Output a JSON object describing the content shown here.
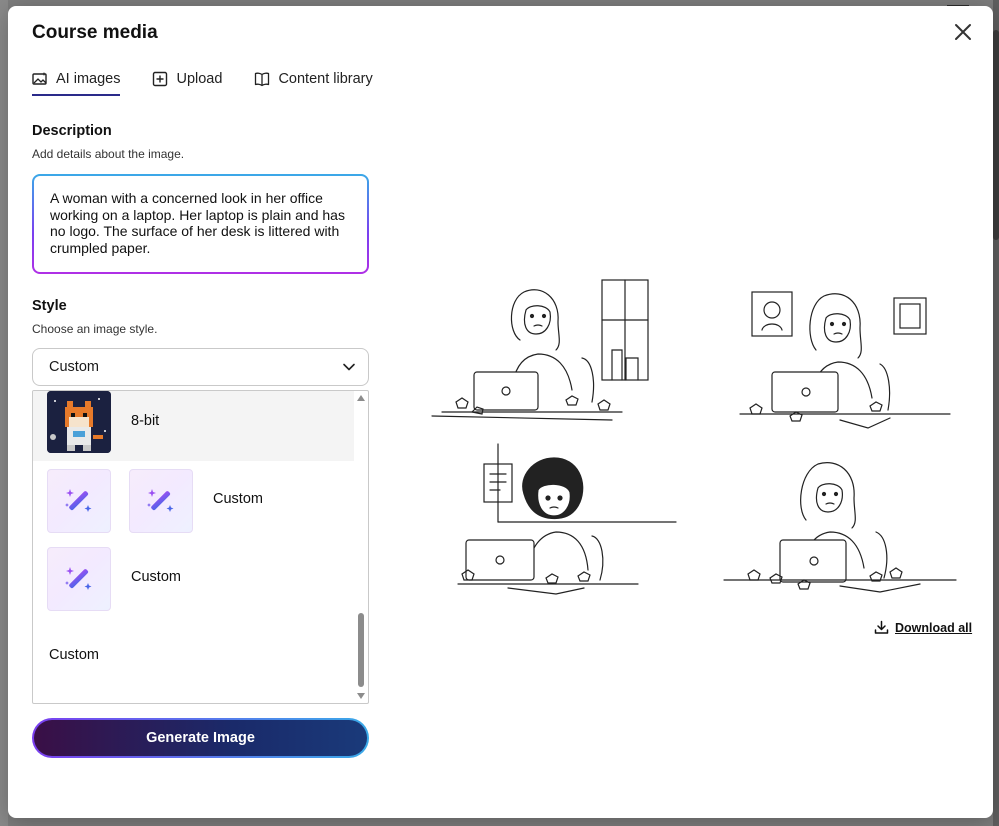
{
  "modal": {
    "title": "Course media"
  },
  "tabs": [
    {
      "label": "AI images",
      "icon": "image-sparkle-icon",
      "active": true
    },
    {
      "label": "Upload",
      "icon": "plus-square-icon",
      "active": false
    },
    {
      "label": "Content library",
      "icon": "book-icon",
      "active": false
    }
  ],
  "description": {
    "label": "Description",
    "help": "Add details about the image.",
    "value": "A woman with a concerned look in her office working on a laptop. Her laptop is plain and has no logo. The surface of her desk is littered with crumpled paper."
  },
  "style": {
    "label": "Style",
    "help": "Choose an image style.",
    "selected": "Custom",
    "options": [
      {
        "label": "8-bit",
        "icon": "pixel-fox-thumbnail"
      },
      {
        "label": "Custom",
        "icon": "magic-wand-icon"
      },
      {
        "label": "Custom",
        "icon": "magic-wand-icon"
      },
      {
        "label": "Custom",
        "icon": "magic-wand-icon"
      },
      {
        "label": "Custom",
        "icon": null
      }
    ]
  },
  "actions": {
    "generate_label": "Generate Image",
    "download_all_label": "Download all"
  },
  "generated_images": [
    {
      "icon": "sketch-woman-laptop-window"
    },
    {
      "icon": "sketch-woman-laptop-frames"
    },
    {
      "icon": "sketch-woman-laptop-notice"
    },
    {
      "icon": "sketch-woman-laptop-plain"
    }
  ],
  "colors": {
    "accent_gradient_start": "#7a3ff0",
    "accent_gradient_end": "#3aa9e8",
    "button_fill": "#1a2a6a",
    "tab_underline": "#2a2a8a"
  }
}
